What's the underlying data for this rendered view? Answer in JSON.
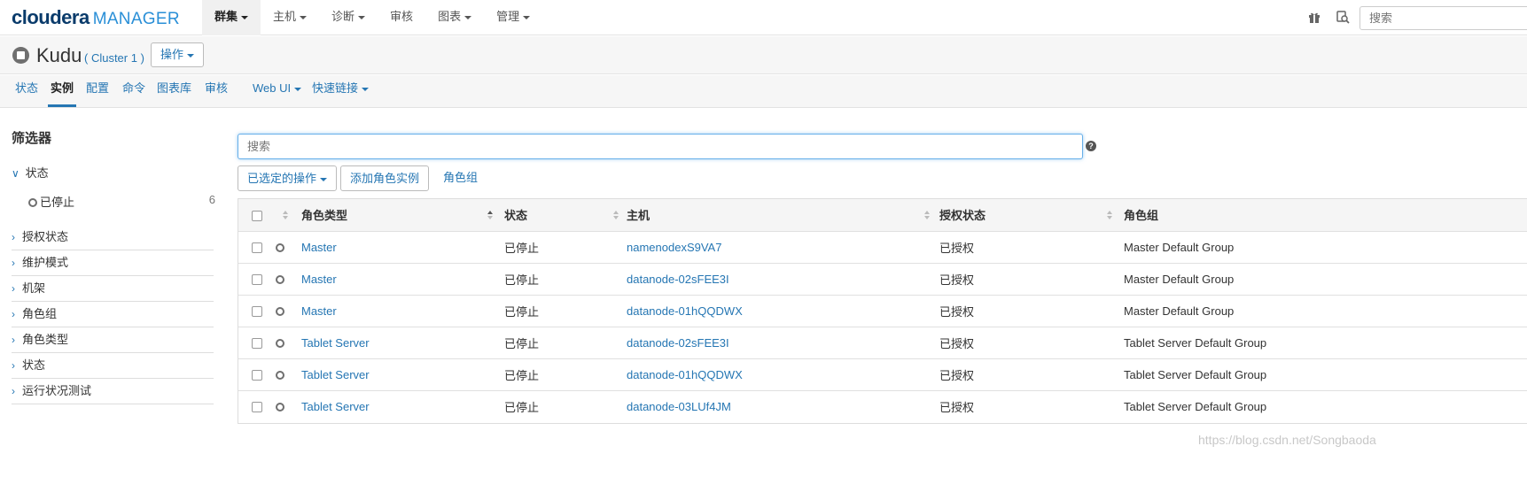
{
  "logo": {
    "brand": "cloudera",
    "product": "MANAGER"
  },
  "topnav": {
    "items": [
      {
        "label": "群集",
        "dropdown": true,
        "active": true
      },
      {
        "label": "主机",
        "dropdown": true
      },
      {
        "label": "诊断",
        "dropdown": true
      },
      {
        "label": "审核",
        "dropdown": false
      },
      {
        "label": "图表",
        "dropdown": true
      },
      {
        "label": "管理",
        "dropdown": true
      }
    ],
    "icons": [
      "gift-icon",
      "search-history-icon"
    ],
    "search_placeholder": "搜索"
  },
  "service": {
    "name": "Kudu",
    "cluster": "( Cluster 1 )",
    "status": "stopped",
    "actions_label": "操作"
  },
  "subnav": {
    "tabs": [
      {
        "label": "状态"
      },
      {
        "label": "实例",
        "active": true
      },
      {
        "label": "配置"
      },
      {
        "label": "命令"
      },
      {
        "label": "图表库"
      },
      {
        "label": "审核"
      },
      {
        "label": "Web UI",
        "dropdown": true
      },
      {
        "label": "快速链接",
        "dropdown": true
      }
    ]
  },
  "sidebar": {
    "title": "筛选器",
    "expanded": {
      "label": "状态",
      "sub": {
        "label": "已停止",
        "count": "6"
      }
    },
    "sections": [
      "授权状态",
      "维护模式",
      "机架",
      "角色组",
      "角色类型",
      "状态",
      "运行状况测试"
    ]
  },
  "main": {
    "search_placeholder": "搜索",
    "help": "?",
    "selected_actions": "已选定的操作",
    "add_role_instance": "添加角色实例",
    "role_groups": "角色组"
  },
  "table": {
    "columns": [
      "角色类型",
      "状态",
      "主机",
      "授权状态",
      "角色组"
    ],
    "rows": [
      {
        "role": "Master",
        "status": "已停止",
        "host": "namenodexS9VA7",
        "auth": "已授权",
        "group": "Master Default Group"
      },
      {
        "role": "Master",
        "status": "已停止",
        "host": "datanode-02sFEE3I",
        "auth": "已授权",
        "group": "Master Default Group"
      },
      {
        "role": "Master",
        "status": "已停止",
        "host": "datanode-01hQQDWX",
        "auth": "已授权",
        "group": "Master Default Group"
      },
      {
        "role": "Tablet Server",
        "status": "已停止",
        "host": "datanode-02sFEE3I",
        "auth": "已授权",
        "group": "Tablet Server Default Group"
      },
      {
        "role": "Tablet Server",
        "status": "已停止",
        "host": "datanode-01hQQDWX",
        "auth": "已授权",
        "group": "Tablet Server Default Group"
      },
      {
        "role": "Tablet Server",
        "status": "已停止",
        "host": "datanode-03LUf4JM",
        "auth": "已授权",
        "group": "Tablet Server Default Group"
      }
    ]
  },
  "watermark": "https://blog.csdn.net/Songbaoda",
  "colors": {
    "link": "#2576b3",
    "brand_dark": "#0a3b6b",
    "brand_light": "#2a8fd7",
    "focus": "#66afe9"
  }
}
